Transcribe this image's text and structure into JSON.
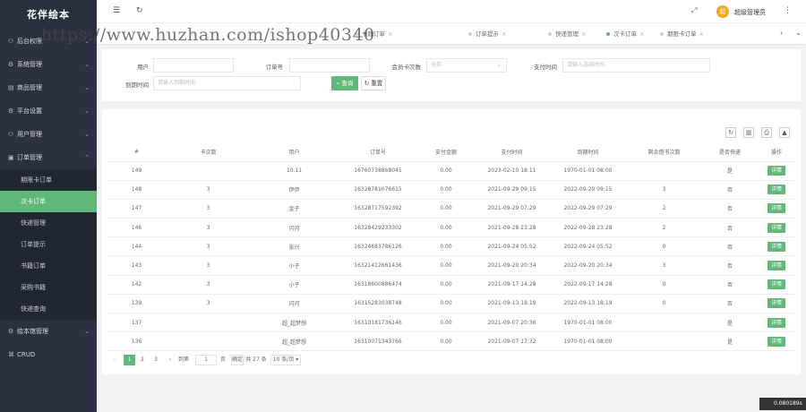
{
  "brand": "花伴绘本",
  "sidebar": {
    "items": [
      {
        "icon": "user-icon",
        "glyph": "⚇",
        "label": "后台权限"
      },
      {
        "icon": "gear-icon",
        "glyph": "⚙",
        "label": "系统管理"
      },
      {
        "icon": "doc-icon",
        "glyph": "▤",
        "label": "商品管理"
      },
      {
        "icon": "gear-icon",
        "glyph": "⚙",
        "label": "平台设置"
      },
      {
        "icon": "user-icon",
        "glyph": "⚇",
        "label": "用户管理"
      },
      {
        "icon": "order-icon",
        "glyph": "▣",
        "label": "订单管理"
      }
    ],
    "submenu": [
      "期限卡订单",
      "次卡订单",
      "快递管理",
      "订单提示",
      "书籍订单",
      "采购书籍",
      "快递查询"
    ],
    "active_sub": 1,
    "after": [
      {
        "icon": "gear-icon",
        "glyph": "⚙",
        "label": "绘本馆管理"
      },
      {
        "icon": "crud-icon",
        "glyph": "⌘",
        "label": "CRUD"
      }
    ]
  },
  "header": {
    "user_initial": "超",
    "user_name": "超级管理员"
  },
  "tabs": [
    {
      "label": "书籍订单"
    },
    {
      "label": "订单提示"
    },
    {
      "label": "快递管理"
    },
    {
      "label": "次卡订单",
      "active": true
    },
    {
      "label": "期限卡订单"
    }
  ],
  "filters": {
    "user_label": "用户",
    "order_no_label": "订单号",
    "card_label": "会员卡次数",
    "card_value": "全部",
    "pay_time_label": "支付时间",
    "pay_time_placeholder": "请输入选择时间",
    "expire_label": "到期时间",
    "expire_placeholder": "请输入到期时间",
    "search_btn": "查询",
    "reset_btn": "重置"
  },
  "table": {
    "headers": [
      "#",
      "卡次数",
      "用户",
      "订单号",
      "支付金额",
      "支付时间",
      "到期时间",
      "剩余借书次数",
      "是否快递",
      "操作"
    ],
    "rows": [
      [
        "149",
        "",
        "10.11",
        "16760738868045",
        "0.00",
        "2023-02-10 18:11",
        "1970-01-01 08:00",
        "",
        "是",
        "详情"
      ],
      [
        "148",
        "3",
        "伊伊",
        "16328781076615",
        "0.00",
        "2021-09-29 09:15",
        "2022-09-29 09:15",
        "3",
        "否",
        "详情"
      ],
      [
        "147",
        "3",
        "金子",
        "16328717592392",
        "0.00",
        "2021-09-29 07:29",
        "2022-09-29 07:29",
        "2",
        "否",
        "详情"
      ],
      [
        "146",
        "3",
        "闪闪",
        "16328429233302",
        "0.00",
        "2021-09-28 23:28",
        "2022-09-28 23:28",
        "2",
        "否",
        "详情"
      ],
      [
        "144",
        "3",
        "张兴",
        "16324683786126",
        "0.00",
        "2021-09-24 05:52",
        "2022-09-24 05:52",
        "0",
        "否",
        "详情"
      ],
      [
        "143",
        "3",
        "小子",
        "16321412661436",
        "0.00",
        "2021-09-20 20:34",
        "2022-09-20 20:34",
        "3",
        "否",
        "详情"
      ],
      [
        "142",
        "3",
        "小子",
        "16318600886474",
        "0.00",
        "2021-09-17 14:28",
        "2022-09-17 14:28",
        "0",
        "否",
        "详情"
      ],
      [
        "139",
        "3",
        "闪闪",
        "16315283038748",
        "0.00",
        "2021-09-13 18:19",
        "2022-09-13 18:19",
        "0",
        "否",
        "详情"
      ],
      [
        "137",
        "",
        "超_超梦想",
        "16310181736146",
        "0.00",
        "2021-09-07 20:36",
        "1970-01-01 08:00",
        "",
        "是",
        "详情"
      ],
      [
        "136",
        "",
        "超_超梦想",
        "16310071343766",
        "0.00",
        "2021-09-07 17:32",
        "1970-01-01 08:00",
        "",
        "是",
        "详情"
      ]
    ]
  },
  "pager": {
    "pages": [
      "1",
      "2",
      "3"
    ],
    "goto_label": "到第",
    "goto_value": "1",
    "page_unit": "页",
    "confirm": "确定",
    "total": "共 27 条",
    "per_page": "10 条/页"
  },
  "badge_text": "0.080189s",
  "watermark": "https://www.huzhan.com/ishop40340"
}
